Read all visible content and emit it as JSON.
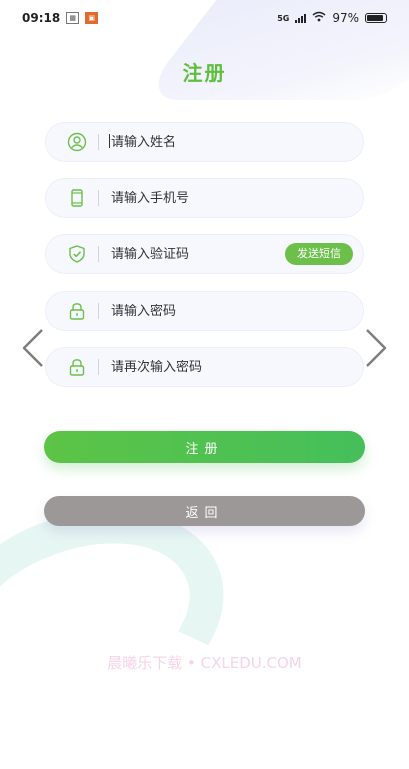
{
  "status_bar": {
    "time": "09:18",
    "network_label": "5G",
    "battery_percent": "97%",
    "battery_level": 0.97
  },
  "page": {
    "title": "注册"
  },
  "form": {
    "name_placeholder": "请输入姓名",
    "phone_placeholder": "请输入手机号",
    "code_placeholder": "请输入验证码",
    "send_sms_label": "发送短信",
    "password_placeholder": "请输入密码",
    "confirm_placeholder": "请再次输入密码"
  },
  "actions": {
    "register_label": "注册",
    "back_label": "返回"
  },
  "watermark": "晨曦乐下载 • CXLEDU.COM",
  "colors": {
    "accent": "#5fbf3d",
    "back_button": "#9d9898",
    "field_bg": "#f7f8fd"
  },
  "icons": [
    "user-icon",
    "phone-icon",
    "shield-check-icon",
    "lock-icon",
    "lock-icon",
    "chevron-left-icon",
    "chevron-right-icon"
  ]
}
